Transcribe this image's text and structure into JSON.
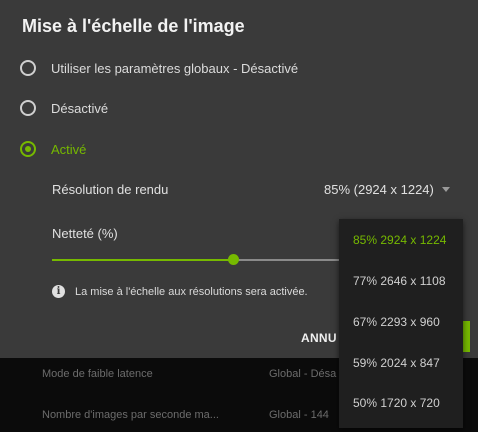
{
  "dialog": {
    "title": "Mise à l'échelle de l'image",
    "options": [
      {
        "label": "Utiliser les paramètres globaux - Désactivé",
        "checked": false
      },
      {
        "label": "Désactivé",
        "checked": false
      },
      {
        "label": "Activé",
        "checked": true
      }
    ],
    "resolution": {
      "label": "Résolution de rendu",
      "value": "85% (2924 x 1224)"
    },
    "sharpness": {
      "label": "Netteté (%)",
      "value_fraction": 0.63
    },
    "info_text": "La mise à l'échelle aux résolutions sera activée.",
    "cancel_label": "ANNU"
  },
  "background_rows": [
    {
      "label": "Mode de faible latence",
      "value": "Global - Désa"
    },
    {
      "label": "Nombre d'images par seconde ma...",
      "value": "Global - 144"
    }
  ],
  "dropdown": {
    "items": [
      {
        "label": "85% 2924 x 1224",
        "selected": true
      },
      {
        "label": "77% 2646 x 1108",
        "selected": false
      },
      {
        "label": "67% 2293 x 960",
        "selected": false
      },
      {
        "label": "59% 2024 x 847",
        "selected": false
      },
      {
        "label": "50% 1720 x 720",
        "selected": false
      }
    ]
  },
  "colors": {
    "accent": "#76b900",
    "dialog_bg": "#3a3a3a",
    "dropdown_bg": "#1f1f1f"
  }
}
